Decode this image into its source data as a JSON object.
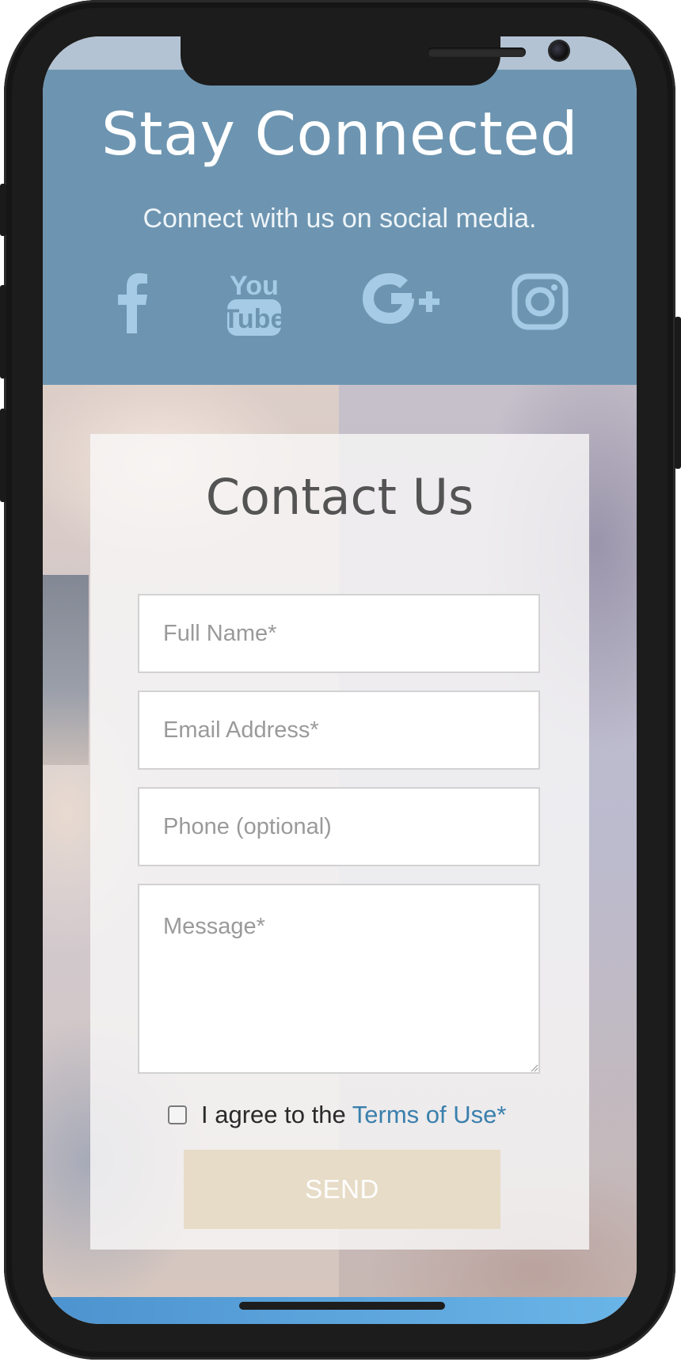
{
  "social": {
    "title": "Stay Connected",
    "subtitle": "Connect with us on social media.",
    "background_color": "#6d95b1",
    "icon_color": "#a6cbe6",
    "icons": [
      {
        "name": "facebook-icon"
      },
      {
        "name": "youtube-icon"
      },
      {
        "name": "google-plus-icon"
      },
      {
        "name": "instagram-icon"
      }
    ]
  },
  "contact": {
    "title": "Contact Us",
    "fields": {
      "full_name_placeholder": "Full Name*",
      "email_placeholder": "Email Address*",
      "phone_placeholder": "Phone (optional)",
      "message_placeholder": "Message*"
    },
    "agree": {
      "prefix": "I agree to the ",
      "link": "Terms of Use*"
    },
    "send_label": "SEND",
    "send_color": "#e7dcc7",
    "link_color": "#3a80ad"
  }
}
